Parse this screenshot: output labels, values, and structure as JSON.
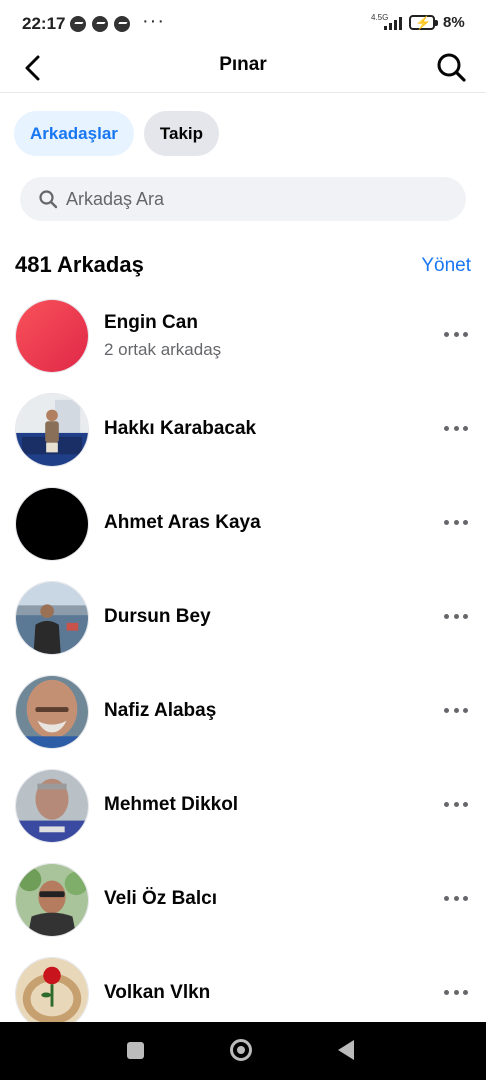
{
  "status_bar": {
    "time": "22:17",
    "notification_icons": [
      "messenger-icon",
      "messenger-icon",
      "messenger-icon"
    ],
    "overflow": "···",
    "network": "4.5G",
    "battery_percent": "8%"
  },
  "header": {
    "title": "Pınar",
    "back_icon": "chevron-left-icon",
    "search_icon": "search-icon"
  },
  "tabs": [
    {
      "label": "Arkadaşlar",
      "active": true
    },
    {
      "label": "Takip",
      "active": false
    }
  ],
  "search": {
    "placeholder": "Arkadaş Ara",
    "value": ""
  },
  "friends_section": {
    "title": "481 Arkadaş",
    "manage_label": "Yönet"
  },
  "friends": [
    {
      "name": "Engin Can",
      "subtitle": "2 ortak arkadaş"
    },
    {
      "name": "Hakkı Karabacak"
    },
    {
      "name": "Ahmet Aras Kaya"
    },
    {
      "name": "Dursun Bey"
    },
    {
      "name": "Nafiz Alabaş"
    },
    {
      "name": "Mehmet Dikkol"
    },
    {
      "name": "Veli Öz Balcı"
    },
    {
      "name": "Volkan Vlkn"
    }
  ],
  "colors": {
    "accent": "#1877f2",
    "tab_active_bg": "#e7f3ff",
    "tab_inactive_bg": "#e4e6eb",
    "search_bg": "#f0f2f5",
    "secondary_text": "#65676b"
  },
  "nav_bar": {
    "buttons": [
      "recents-icon",
      "home-icon",
      "back-icon"
    ]
  }
}
